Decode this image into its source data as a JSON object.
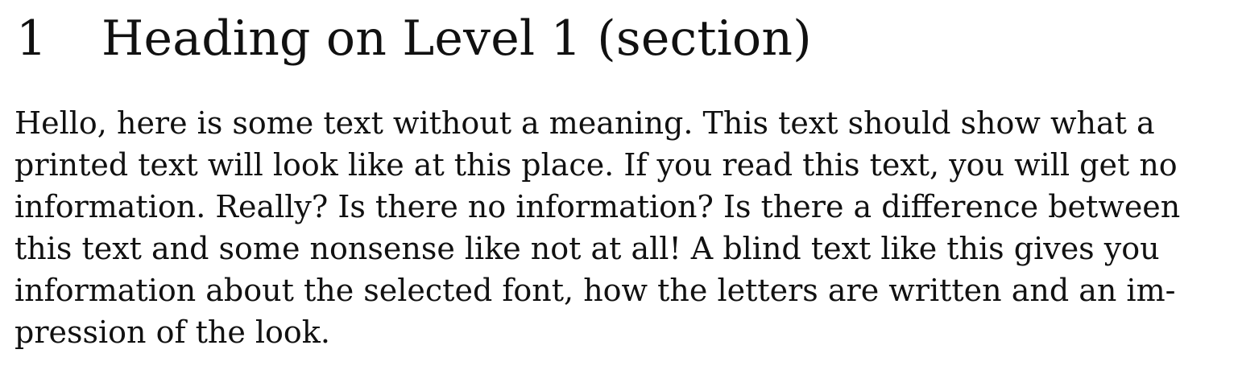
{
  "section": {
    "number": "1",
    "title": "Heading on Level 1 (section)"
  },
  "paragraph": {
    "lines": [
      "Hello, here is some text without a meaning. This text should show what a",
      "printed text will look like at this place. If you read this text, you will get no",
      "information. Really? Is there no information? Is there a difference between",
      "this text and some nonsense like not at all! A blind text like this gives you",
      "information about the selected font, how the letters are written and an im-",
      "pression of the look."
    ]
  }
}
